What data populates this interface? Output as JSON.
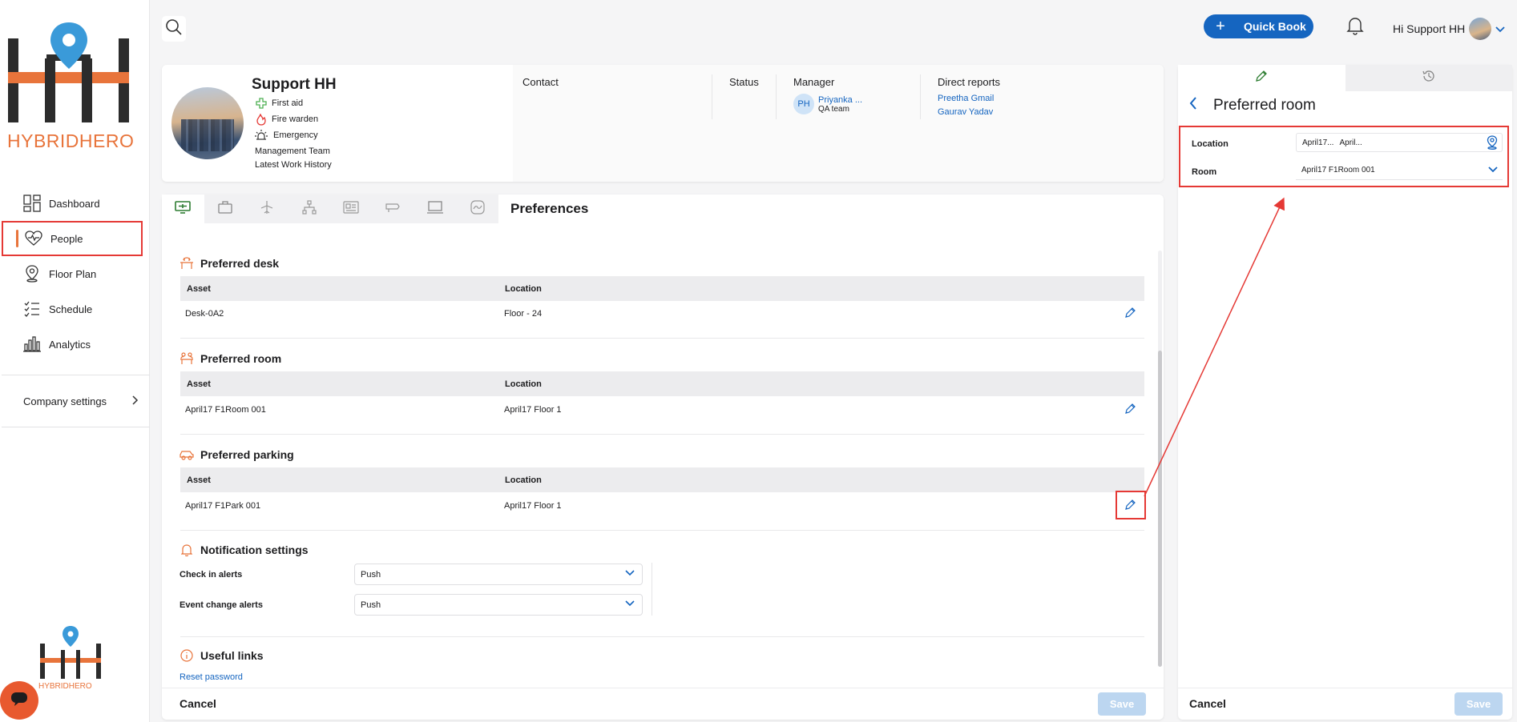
{
  "brand": {
    "logo_text_1": "HYBRID",
    "logo_text_2": "HERO",
    "small_logo_text": "HYBRIDHERO"
  },
  "sidebar": {
    "items": [
      {
        "label": "Dashboard",
        "icon": "dashboard-icon"
      },
      {
        "label": "People",
        "icon": "heart-pulse-icon",
        "active": true
      },
      {
        "label": "Floor Plan",
        "icon": "map-pin-icon"
      },
      {
        "label": "Schedule",
        "icon": "checklist-icon"
      },
      {
        "label": "Analytics",
        "icon": "bar-chart-icon"
      }
    ],
    "company_settings": "Company settings"
  },
  "topbar": {
    "quick_book": "Quick Book",
    "greeting": "Hi Support HH"
  },
  "profile": {
    "name": "Support HH",
    "roles": [
      "First aid",
      "Fire warden",
      "Emergency"
    ],
    "team": "Management Team",
    "history": "Latest Work History",
    "contact_label": "Contact",
    "status_label": "Status",
    "manager_label": "Manager",
    "manager_initials": "PH",
    "manager_name": "Priyanka ...",
    "manager_team": "QA team",
    "direct_reports_label": "Direct reports",
    "direct_reports": [
      "Preetha Gmail",
      "Gaurav Yadav"
    ]
  },
  "main": {
    "title": "Preferences",
    "sections": {
      "desk": {
        "title": "Preferred desk",
        "col_asset": "Asset",
        "col_location": "Location",
        "asset": "Desk-0A2",
        "location": "Floor - 24"
      },
      "room": {
        "title": "Preferred room",
        "col_asset": "Asset",
        "col_location": "Location",
        "asset": "April17 F1Room 001",
        "location": "April17 Floor 1"
      },
      "parking": {
        "title": "Preferred parking",
        "col_asset": "Asset",
        "col_location": "Location",
        "asset": "April17 F1Park 001",
        "location": "April17 Floor 1"
      },
      "notifications": {
        "title": "Notification settings",
        "check_in_label": "Check in alerts",
        "check_in_value": "Push",
        "event_change_label": "Event change alerts",
        "event_change_value": "Push"
      },
      "links": {
        "title": "Useful links",
        "reset_password": "Reset password"
      }
    },
    "cancel": "Cancel",
    "save": "Save"
  },
  "right_panel": {
    "title": "Preferred room",
    "location_label": "Location",
    "location_value_1": "April17...",
    "location_value_2": "April...",
    "room_label": "Room",
    "room_value": "April17 F1Room 001",
    "cancel": "Cancel",
    "save": "Save"
  },
  "colors": {
    "accent": "#1565c0",
    "brand_orange": "#e8743b",
    "highlight": "#e53935"
  }
}
